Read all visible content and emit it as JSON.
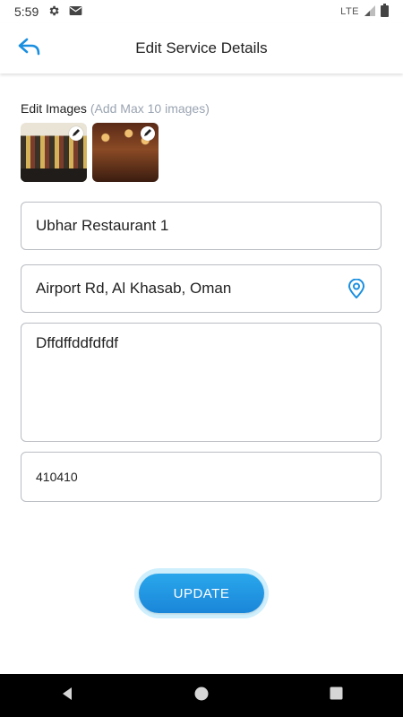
{
  "status_bar": {
    "time": "5:59",
    "network": "LTE",
    "icons": [
      "gear-icon",
      "mail-icon",
      "signal-icon",
      "battery-icon"
    ]
  },
  "header": {
    "title": "Edit Service Details",
    "back_icon": "back-arrow-icon"
  },
  "images": {
    "label": "Edit Images",
    "hint": "(Add Max 10 images)",
    "items": [
      {
        "name": "restaurant-image-1",
        "edit_icon": "pencil-icon"
      },
      {
        "name": "restaurant-image-2",
        "edit_icon": "pencil-icon"
      }
    ]
  },
  "form": {
    "name_value": "Ubhar Restaurant 1",
    "location_value": "Airport Rd, Al Khasab, Oman",
    "location_icon": "location-pin-icon",
    "description_value": "Dffdffddfdfdf",
    "phone_value": "410410"
  },
  "actions": {
    "update_label": "UPDATE"
  },
  "nav": {
    "icons": [
      "back-triangle-icon",
      "home-circle-icon",
      "recents-square-icon"
    ]
  },
  "colors": {
    "accent": "#1a8fe0",
    "hint": "#9aa4b1",
    "border": "#b9bcc2"
  }
}
